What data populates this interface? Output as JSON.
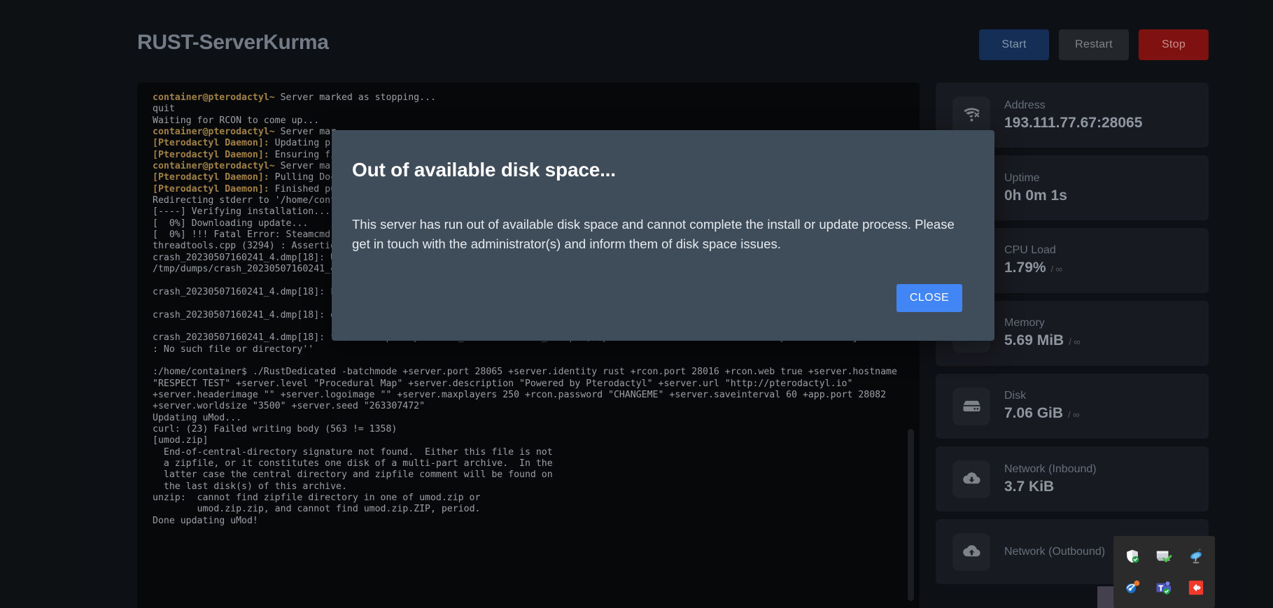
{
  "header": {
    "server_title": "RUST-ServerKurma",
    "buttons": [
      {
        "name": "start",
        "label": "Start"
      },
      {
        "name": "restart",
        "label": "Restart"
      },
      {
        "name": "stop",
        "label": "Stop"
      }
    ]
  },
  "console": {
    "lines": [
      {
        "type": "prompt",
        "prefix": "container@pterodactyl~",
        "text": " Server marked as stopping..."
      },
      {
        "type": "plain",
        "text": "quit"
      },
      {
        "type": "plain",
        "text": "Waiting for RCON to come up..."
      },
      {
        "type": "prompt",
        "prefix": "container@pterodactyl~",
        "text": " Server mar"
      },
      {
        "type": "daemon",
        "prefix": "[Pterodactyl Daemon]:",
        "text": " Updating pr"
      },
      {
        "type": "daemon",
        "prefix": "[Pterodactyl Daemon]:",
        "text": " Ensuring fi"
      },
      {
        "type": "prompt",
        "prefix": "container@pterodactyl~",
        "text": " Server mar"
      },
      {
        "type": "daemon",
        "prefix": "[Pterodactyl Daemon]:",
        "text": " Pulling Doc"
      },
      {
        "type": "daemon",
        "prefix": "[Pterodactyl Daemon]:",
        "text": " Finished pu"
      },
      {
        "type": "plain",
        "text": "Redirecting stderr to '/home/cont"
      },
      {
        "type": "plain",
        "text": "[----] Verifying installation..."
      },
      {
        "type": "plain",
        "text": "[  0%] Downloading update..."
      },
      {
        "type": "plain",
        "text": "[  0%] !!! Fatal Error: Steamcmd"
      },
      {
        "type": "plain",
        "text": "threadtools.cpp (3294) : Assertio"
      },
      {
        "type": "plain",
        "text": "crash_20230507160241_4.dmp[18]: U"
      },
      {
        "type": "plain",
        "text": "/tmp/dumps/crash_20230507160241_4"
      },
      {
        "type": "blank",
        "text": ""
      },
      {
        "type": "plain",
        "text": "crash_20230507160241_4.dmp[18]: F"
      },
      {
        "type": "blank",
        "text": ""
      },
      {
        "type": "plain",
        "text": "crash_20230507160241_4.dmp[18]: error: libcurl.so: cannot open shared object file: No such file or directory"
      },
      {
        "type": "blank",
        "text": ""
      },
      {
        "type": "plain",
        "text": "crash_20230507160241_4.dmp[18]: file ''/tmp/dumps/crash_20230507160241_4.dmp'', upload no: ''libcurl.so: cannot open shared object file\n: No such file or directory''"
      },
      {
        "type": "blank",
        "text": ""
      },
      {
        "type": "plain",
        "text": ":/home/container$ ./RustDedicated -batchmode +server.port 28065 +server.identity rust +rcon.port 28016 +rcon.web true +server.hostname \"RESPECT TEST\" +server.level \"Procedural Map\" +server.description \"Powered by Pterodactyl\" +server.url \"http://pterodactyl.io\" +server.headerimage \"\" +server.logoimage \"\" +server.maxplayers 250 +rcon.password \"CHANGEME\" +server.saveinterval 60 +app.port 28082 +server.worldsize \"3500\" +server.seed \"263307472\""
      },
      {
        "type": "plain",
        "text": "Updating uMod..."
      },
      {
        "type": "plain",
        "text": "curl: (23) Failed writing body (563 != 1358)"
      },
      {
        "type": "plain",
        "text": "[umod.zip]"
      },
      {
        "type": "plain",
        "text": "  End-of-central-directory signature not found.  Either this file is not"
      },
      {
        "type": "plain",
        "text": "  a zipfile, or it constitutes one disk of a multi-part archive.  In the"
      },
      {
        "type": "plain",
        "text": "  latter case the central directory and zipfile comment will be found on"
      },
      {
        "type": "plain",
        "text": "  the last disk(s) of this archive."
      },
      {
        "type": "plain",
        "text": "unzip:  cannot find zipfile directory in one of umod.zip or"
      },
      {
        "type": "plain",
        "text": "        umod.zip.zip, and cannot find umod.zip.ZIP, period."
      },
      {
        "type": "plain",
        "text": "Done updating uMod!"
      }
    ]
  },
  "stats": [
    {
      "icon": "wifi-off-icon",
      "label": "Address",
      "value": "193.111.77.67:28065",
      "limit": ""
    },
    {
      "icon": "clock-icon",
      "label": "Uptime",
      "value": "0h 0m 1s",
      "limit": ""
    },
    {
      "icon": "microchip-icon",
      "label": "CPU Load",
      "value": "1.79%",
      "limit": "/ ∞"
    },
    {
      "icon": "memory-icon",
      "label": "Memory",
      "value": "5.69 MiB",
      "limit": "/ ∞"
    },
    {
      "icon": "hard-drive-icon",
      "label": "Disk",
      "value": "7.06 GiB",
      "limit": "/ ∞"
    },
    {
      "icon": "cloud-download-icon",
      "label": "Network (Inbound)",
      "value": "3.7 KiB",
      "limit": ""
    },
    {
      "icon": "cloud-upload-icon",
      "label": "Network (Outbound)",
      "value": "",
      "limit": ""
    }
  ],
  "modal": {
    "title": "Out of available disk space...",
    "body": "This server has run out of available disk space and cannot complete the install or update process. Please get in touch with the administrator(s) and inform them of disk space issues.",
    "close_label": "CLOSE"
  },
  "tray": {
    "icons": [
      {
        "name": "windows-security-shield-icon"
      },
      {
        "name": "windows-update-checkmark-icon"
      },
      {
        "name": "satellite-dish-icon"
      },
      {
        "name": "network-alert-icon"
      },
      {
        "name": "microsoft-teams-icon"
      },
      {
        "name": "red-diamond-app-icon"
      }
    ]
  },
  "colors": {
    "page_background": "#0f1216",
    "console_background": "#07090b",
    "card_background": "#191d23",
    "modal_background": "#3f4c59",
    "accent_blue": "#4285f4",
    "start_button": "#16325c",
    "stop_button": "#8a1313",
    "prompt_text": "#b08b4c"
  }
}
